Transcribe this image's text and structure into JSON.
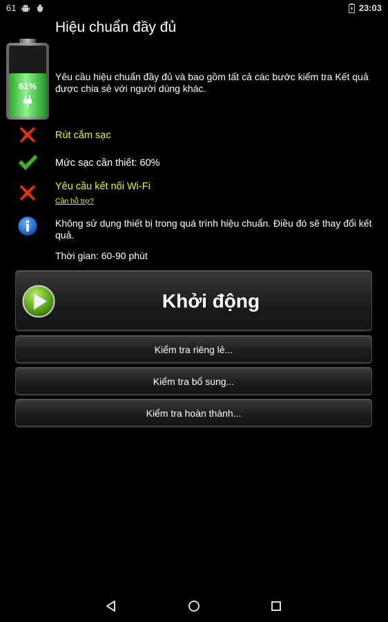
{
  "status_bar": {
    "left_number": "61",
    "time": "23:03"
  },
  "header": {
    "title": "Hiệu chuẩn đầy đủ",
    "description": "Yêu cầu hiệu chuẩn đầy đủ và bao gồm tất cả các bước kiểm tra Kết quả được chia sẻ với người dùng khác.",
    "battery_percent": "61%",
    "battery_level": 0.61
  },
  "requirements": [
    {
      "icon": "red-x-icon",
      "text": "Rút cắm sạc",
      "met": false
    },
    {
      "icon": "green-check-icon",
      "text": "Mức sạc cần thiết: 60%",
      "met": true
    },
    {
      "icon": "red-x-icon",
      "text": "Yêu cầu kết nối Wi-Fi",
      "met": false
    }
  ],
  "help_link": "Cần hỗ trợ?",
  "warning": "Không sử dụng thiết bị trong quá trình hiệu chuẩn. Điều đó sẽ thay đổi kết quả.",
  "duration": "Thời gian: 60-90 phút",
  "buttons": {
    "start": "Khởi động",
    "individual": "Kiểm tra riêng lẻ...",
    "additional": "Kiểm tra bổ sung...",
    "complete": "Kiểm tra hoàn thành..."
  },
  "colors": {
    "warning_yellow": "#f2f21c",
    "battery_green": "#3bd23b",
    "error_red": "#e0341c",
    "ok_green": "#4caf2a",
    "info_blue": "#1a73d9"
  }
}
